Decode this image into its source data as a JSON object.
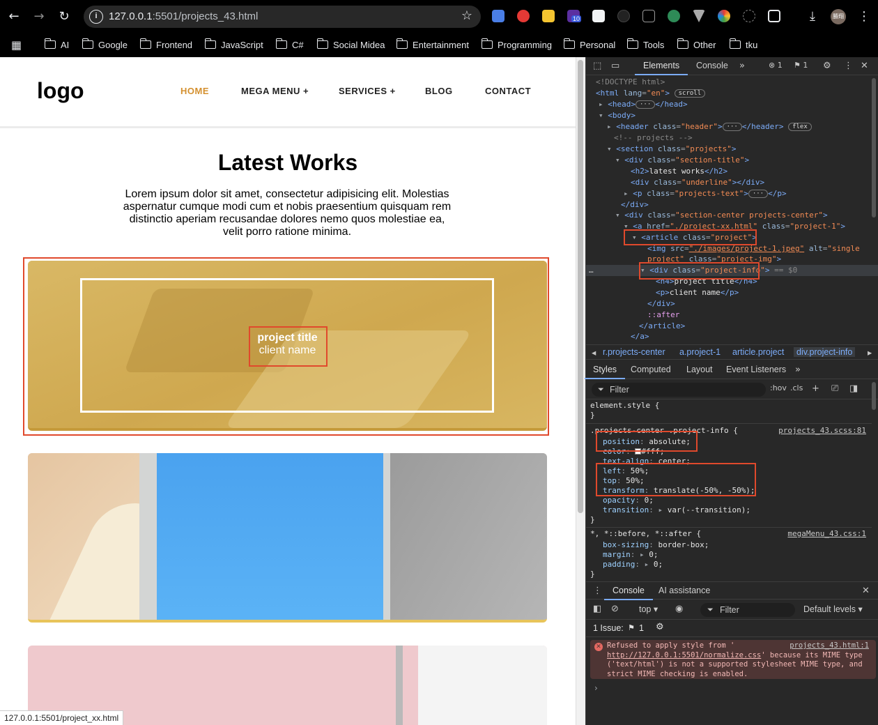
{
  "browser": {
    "url_host": "127.0.0.1",
    "url_path": ":5501/projects_43.html",
    "bookmarks": [
      "AI",
      "Google",
      "Frontend",
      "JavaScript",
      "C#",
      "Social Midea",
      "Entertainment",
      "Programming",
      "Personal",
      "Tools",
      "Other",
      "tku"
    ],
    "extension_badge": "10",
    "avatar_text": "勝翔",
    "status_url": "127.0.0.1:5501/project_xx.html"
  },
  "site": {
    "logo": "logo",
    "nav": [
      "HOME",
      "MEGA MENU +",
      "SERVICES +",
      "BLOG",
      "CONTACT"
    ],
    "section_title": "Latest Works",
    "projects_text": "Lorem ipsum dolor sit amet, consectetur adipisicing elit. Molestias aspernatur cumque modi cum et nobis praesentium quisquam rem distinctio aperiam recusandae dolores nemo quos molestiae ea, velit porro ratione minima.",
    "project_title": "project title",
    "client_name": "client name",
    "accent_color": "#d4902f"
  },
  "devtools": {
    "tabs": [
      "Elements",
      "Console"
    ],
    "error_count": "1",
    "issue_count": "1",
    "dom": {
      "doctype": "<!DOCTYPE html>",
      "comment_projects": "<!-- projects -->",
      "h2_text": "latest works",
      "h4_text": "project title",
      "p_text": "client name",
      "pseudo_after": "::after",
      "sel_marker": "== $0"
    },
    "breadcrumb": [
      "r.projects-center",
      "a.project-1",
      "article.project",
      "div.project-info"
    ],
    "style_tabs": [
      "Styles",
      "Computed",
      "Layout",
      "Event Listeners"
    ],
    "filter_placeholder": "Filter",
    "hov": ":hov",
    "cls": ".cls",
    "rules": {
      "element_style": "element.style {",
      "selector1": ".projects-center .project-info {",
      "source1": "projects_43.scss:81",
      "props1": [
        [
          "position",
          "absolute;"
        ],
        [
          "color",
          "#fff;"
        ],
        [
          "text-align",
          "center;"
        ],
        [
          "left",
          "50%;"
        ],
        [
          "top",
          "50%;"
        ],
        [
          "transform",
          "translate(-50%, -50%);"
        ],
        [
          "opacity",
          "0;"
        ],
        [
          "transition",
          "var(--transition);"
        ]
      ],
      "selector2": "*, *::before, *::after {",
      "source2": "megaMenu_43.css:1",
      "props2": [
        [
          "box-sizing",
          "border-box;"
        ],
        [
          "margin",
          "0;"
        ],
        [
          "padding",
          "0;"
        ]
      ]
    },
    "console": {
      "tabs": [
        "Console",
        "AI assistance"
      ],
      "context": "top",
      "filter": "Filter",
      "levels": "Default levels",
      "issues_label": "1 Issue:",
      "issues_count": "1",
      "error_source": "projects_43.html:1",
      "error_prefix": "Refused to apply style from '",
      "error_link": "http://127.0.0.1:5501/normalize.css",
      "error_rest": "' because its MIME type ('text/html') is not a supported stylesheet MIME type, and strict MIME checking is enabled."
    }
  }
}
